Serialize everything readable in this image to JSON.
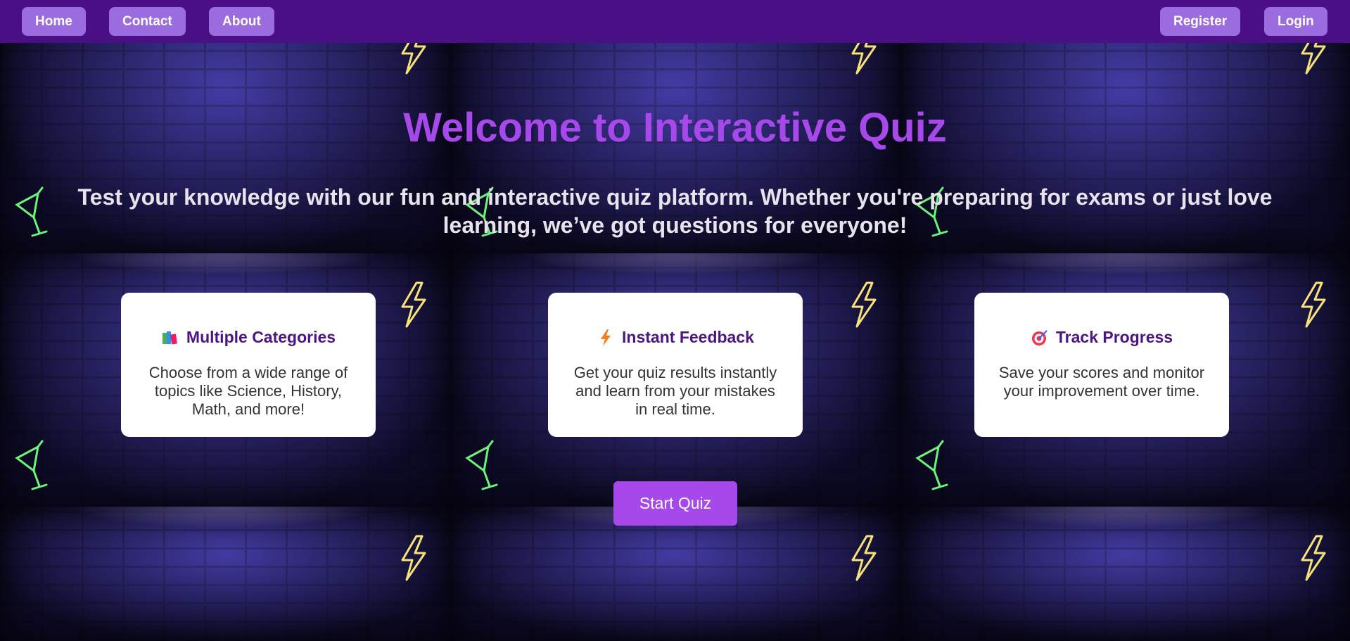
{
  "nav": {
    "home": "Home",
    "contact": "Contact",
    "about": "About",
    "register": "Register",
    "login": "Login"
  },
  "hero": {
    "title": "Welcome to Interactive Quiz",
    "subtitle": "Test your knowledge with our fun and interactive quiz platform. Whether you're preparing for exams or just love learning, we’ve got questions for everyone!"
  },
  "features": [
    {
      "icon": "books-icon",
      "title": "Multiple Categories",
      "description": "Choose from a wide range of topics like Science, History, Math, and more!"
    },
    {
      "icon": "lightning-icon",
      "title": "Instant Feedback",
      "description": "Get your quiz results instantly and learn from your mistakes in real time."
    },
    {
      "icon": "target-icon",
      "title": "Track Progress",
      "description": "Save your scores and monitor your improvement over time."
    }
  ],
  "cta": {
    "start_label": "Start Quiz"
  },
  "colors": {
    "navbar": "#4b0f85",
    "nav_button": "#9b6be0",
    "accent": "#a748eb",
    "card_title": "#4b1582"
  }
}
